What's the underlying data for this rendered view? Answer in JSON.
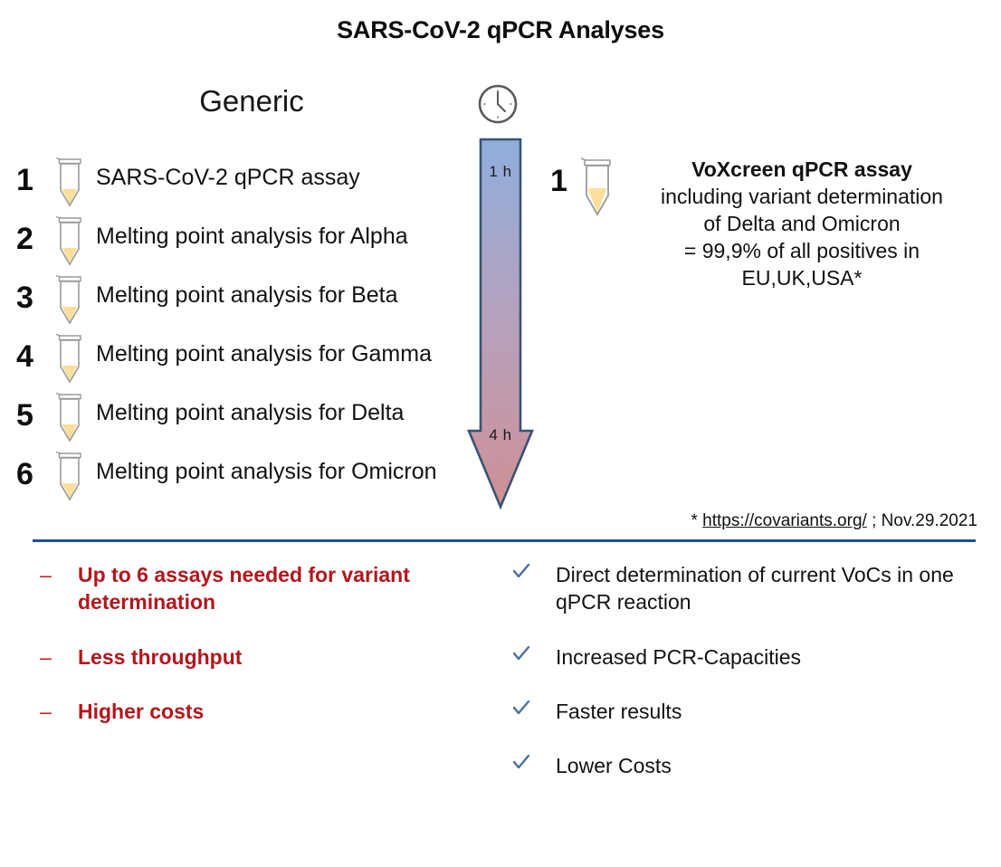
{
  "title": "SARS-CoV-2 qPCR Analyses",
  "generic": {
    "heading": "Generic",
    "rows": [
      {
        "number": "1",
        "label": "SARS-CoV-2 qPCR assay"
      },
      {
        "number": "2",
        "label": "Melting point analysis for Alpha"
      },
      {
        "number": "3",
        "label": "Melting point analysis for Beta"
      },
      {
        "number": "4",
        "label": "Melting point analysis for Gamma"
      },
      {
        "number": "5",
        "label": "Melting point analysis for Delta"
      },
      {
        "number": "6",
        "label": "Melting point analysis for Omicron"
      }
    ]
  },
  "timeline": {
    "clock_icon": "clock-icon",
    "top_label": "1 h",
    "bottom_label": "4 h",
    "top_color": "#8faedc",
    "bottom_color": "#cf9095",
    "border_color": "#3a5372"
  },
  "voxcreen": {
    "number": "1",
    "title": "VoXcreen qPCR assay",
    "lines": [
      "including  variant  determination",
      "of Delta and Omicron",
      "= 99,9%  of all positives  in",
      "EU,UK,USA*"
    ]
  },
  "footnote": {
    "asterisk": "*",
    "link": "https://covariants.org/",
    "suffix": "; Nov.29.2021"
  },
  "divider_color": "#1f4e9c",
  "cons": {
    "bullet": "–",
    "color": "#b3161c",
    "items": [
      "Up to 6 assays needed for variant determination",
      "Less throughput",
      "Higher costs"
    ]
  },
  "pros": {
    "bullet_icon": "check-icon",
    "color": "#4a6f9e",
    "items": [
      "Direct determination of current VoCs in one qPCR reaction",
      "Increased PCR-Capacities",
      "Faster results",
      "Lower Costs"
    ]
  }
}
